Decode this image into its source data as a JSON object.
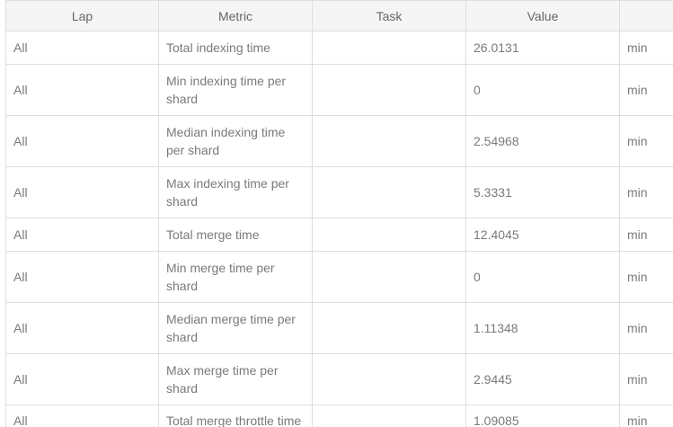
{
  "table": {
    "headers": [
      "Lap",
      "Metric",
      "Task",
      "Value",
      ""
    ],
    "rows": [
      {
        "lap": "All",
        "metric": "Total indexing time",
        "task": "",
        "value": "26.0131",
        "unit": "min"
      },
      {
        "lap": "All",
        "metric": "Min indexing time per shard",
        "task": "",
        "value": "0",
        "unit": "min"
      },
      {
        "lap": "All",
        "metric": "Median indexing time per shard",
        "task": "",
        "value": "2.54968",
        "unit": "min"
      },
      {
        "lap": "All",
        "metric": "Max indexing time per shard",
        "task": "",
        "value": "5.3331",
        "unit": "min"
      },
      {
        "lap": "All",
        "metric": "Total merge time",
        "task": "",
        "value": "12.4045",
        "unit": "min"
      },
      {
        "lap": "All",
        "metric": "Min merge time per shard",
        "task": "",
        "value": "0",
        "unit": "min"
      },
      {
        "lap": "All",
        "metric": "Median merge time per shard",
        "task": "",
        "value": "1.11348",
        "unit": "min"
      },
      {
        "lap": "All",
        "metric": "Max merge time per shard",
        "task": "",
        "value": "2.9445",
        "unit": "min"
      },
      {
        "lap": "All",
        "metric": "Total merge throttle time",
        "task": "",
        "value": "1.09085",
        "unit": "min"
      }
    ]
  }
}
